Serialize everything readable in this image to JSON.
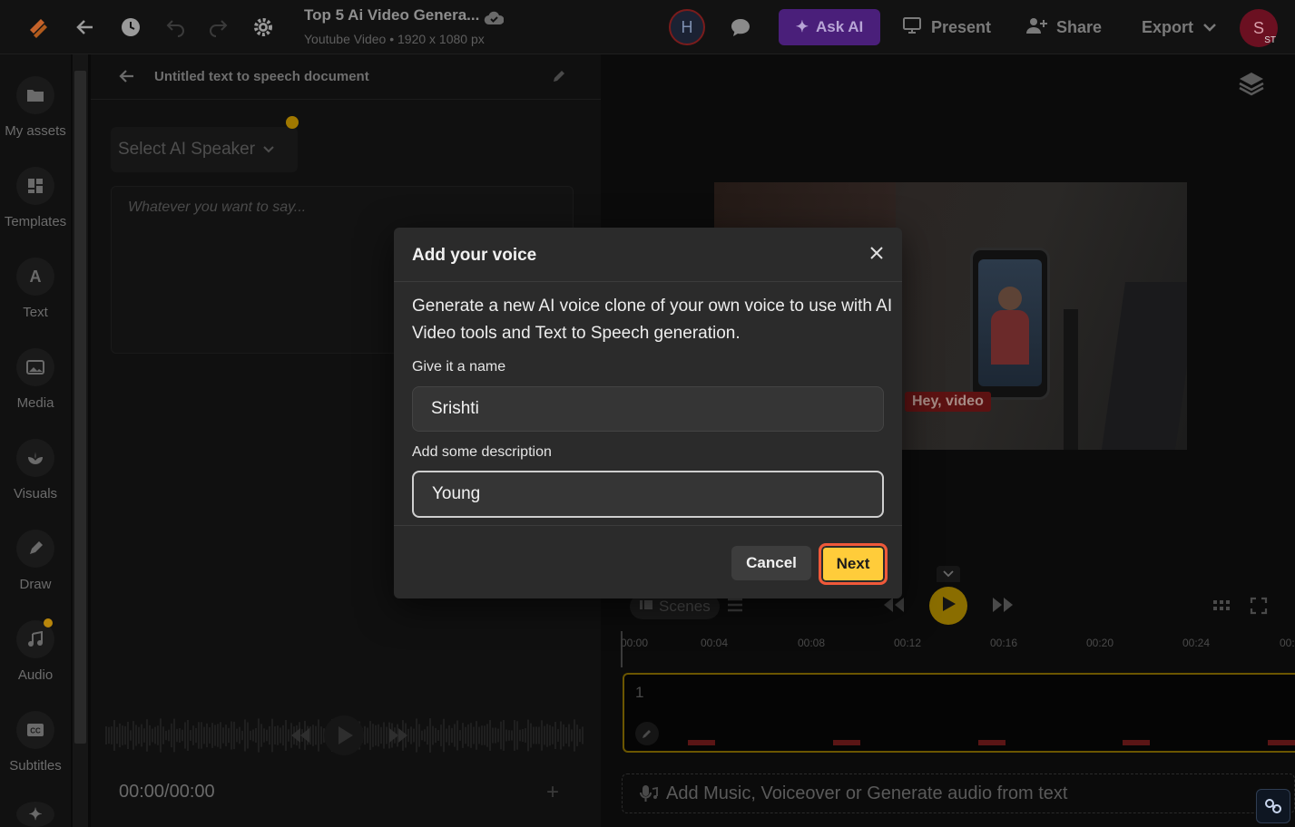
{
  "topbar": {
    "project_title": "Top 5 Ai Video Genera...",
    "project_subtitle": "Youtube Video • 1920 x 1080 px",
    "avatar_h": "H",
    "ask_ai_label": "Ask AI",
    "present_label": "Present",
    "share_label": "Share",
    "export_label": "Export",
    "user_initial": "S",
    "user_badge": "ST"
  },
  "rail": {
    "items": [
      {
        "label": "My assets",
        "icon": "folder-icon"
      },
      {
        "label": "Templates",
        "icon": "templates-icon"
      },
      {
        "label": "Text",
        "icon": "text-icon"
      },
      {
        "label": "Media",
        "icon": "image-icon"
      },
      {
        "label": "Visuals",
        "icon": "visuals-icon"
      },
      {
        "label": "Draw",
        "icon": "pen-icon"
      },
      {
        "label": "Audio",
        "icon": "music-icon"
      },
      {
        "label": "Subtitles",
        "icon": "cc-icon"
      }
    ]
  },
  "tts_panel": {
    "title": "Untitled text to speech document",
    "speaker_placeholder": "Select AI Speaker",
    "text_placeholder": "Whatever you want to say...",
    "time": "00:00/00:00"
  },
  "editor": {
    "caption": "Hey, video",
    "scenes_label": "Scenes",
    "ruler": [
      "00:00",
      "00:04",
      "00:08",
      "00:12",
      "00:16",
      "00:20",
      "00:24",
      "00:"
    ],
    "track_number": "1",
    "add_music_label": "Add Music, Voiceover or Generate audio from text"
  },
  "modal": {
    "title": "Add your voice",
    "description": "Generate a new AI voice clone of your own voice to use with AI Video tools and Text to Speech generation.",
    "name_label": "Give it a name",
    "name_value": "Srishti",
    "desc_label": "Add some description",
    "desc_value": "Young",
    "cancel_label": "Cancel",
    "next_label": "Next"
  },
  "colors": {
    "accent_yellow": "#ffcc3a",
    "next_border": "#f0593a",
    "ask_ai_purple": "#4a1f7a",
    "modal_bg": "#2b2b2b"
  }
}
